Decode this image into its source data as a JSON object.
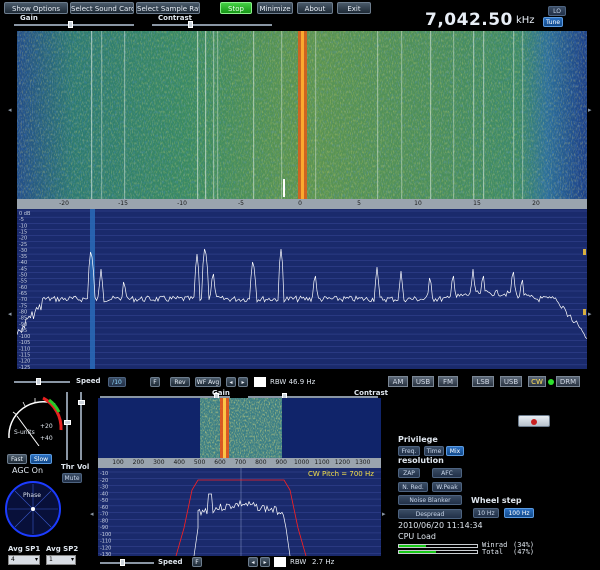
{
  "toolbar": {
    "show_options": "Show Options",
    "select_sound_card": "Select Sound Card",
    "select_sample_rate": "Select Sample Rate",
    "stop": "Stop",
    "minimize": "Minimize",
    "about": "About",
    "exit": "Exit"
  },
  "top_sliders": {
    "gain": "Gain",
    "contrast": "Contrast"
  },
  "frequency": {
    "value": "7,042.50",
    "unit": "kHz",
    "lo_label": "LO",
    "tune_label": "Tune"
  },
  "main_spectrum": {
    "x_ticks": [
      "-20",
      "-15",
      "-10",
      "-5",
      "0",
      "5",
      "10",
      "15",
      "20"
    ],
    "db_labels": [
      "0 dB",
      "-5",
      "-10",
      "-15",
      "-20",
      "-25",
      "-30",
      "-35",
      "-40",
      "-45",
      "-50",
      "-55",
      "-60",
      "-65",
      "-70",
      "-75",
      "-80",
      "-85",
      "-90",
      "-95",
      "-100",
      "-105",
      "-110",
      "-115",
      "-120",
      "-125"
    ]
  },
  "controls_row": {
    "speed": "Speed",
    "speed_value": "/10",
    "f_label": "F",
    "rev_label": "Rev",
    "wf_avg": "WF Avg",
    "rbw": "RBW 46.9 Hz"
  },
  "modes": [
    "AM",
    "USB",
    "FM",
    "LSB",
    "USB",
    "CW",
    "DRM"
  ],
  "selected_mode": "CW",
  "smeter": {
    "label": "S-units",
    "plus20": "+20",
    "plus40": "+40"
  },
  "agc": {
    "fast": "Fast",
    "slow": "Slow",
    "status": "AGC On",
    "thr": "Thr",
    "vol": "Vol",
    "mute": "Mute"
  },
  "phase": {
    "label": "Phase"
  },
  "avg": {
    "sp1_label": "Avg SP1",
    "sp1_value": "4",
    "sp2_label": "Avg SP2",
    "sp2_value": "1"
  },
  "cw_panel": {
    "gain": "Gain",
    "contrast": "Contrast",
    "hz_ticks": [
      "100",
      "200",
      "300",
      "400",
      "500",
      "600",
      "700",
      "800",
      "900",
      "1000",
      "1100",
      "1200",
      "1300"
    ],
    "db_labels": [
      "-10",
      "-20",
      "-30",
      "-40",
      "-50",
      "-60",
      "-70",
      "-80",
      "-90",
      "-100",
      "-110",
      "-120",
      "-130"
    ],
    "cw_pitch": "CW Pitch = 700 Hz",
    "speed": "Speed",
    "f_label": "F",
    "rbw": "RBW",
    "rbw_value": "2.7 Hz"
  },
  "privilege": {
    "title": "Privilege",
    "freq": "Freq.",
    "time": "Time",
    "mix": "Mix",
    "resolution": "resolution",
    "zap": "ZAP",
    "afc": "AFC",
    "n_red": "N. Red.",
    "w_peak": "W.Peak",
    "noise_blanker": "Noise Blanker",
    "despread": "Despread",
    "wheel_step": "Wheel step",
    "hz10": "10 Hz",
    "hz100": "100 Hz"
  },
  "status": {
    "datetime": "2010/06/20 11:14:34",
    "cpu_load": "CPU Load",
    "winrad_label": "Winrad",
    "winrad_pct": "(34%)",
    "total_label": "Total",
    "total_pct": "(47%)"
  },
  "cpu_values": {
    "winrad": 0.34,
    "total": 0.47
  },
  "colors": {
    "accent_blue": "#2a6fc0",
    "stop_green": "#2bb52b",
    "trace": "#ffffff",
    "red_trace": "#ff2020",
    "cpu_green": "#18c818"
  }
}
